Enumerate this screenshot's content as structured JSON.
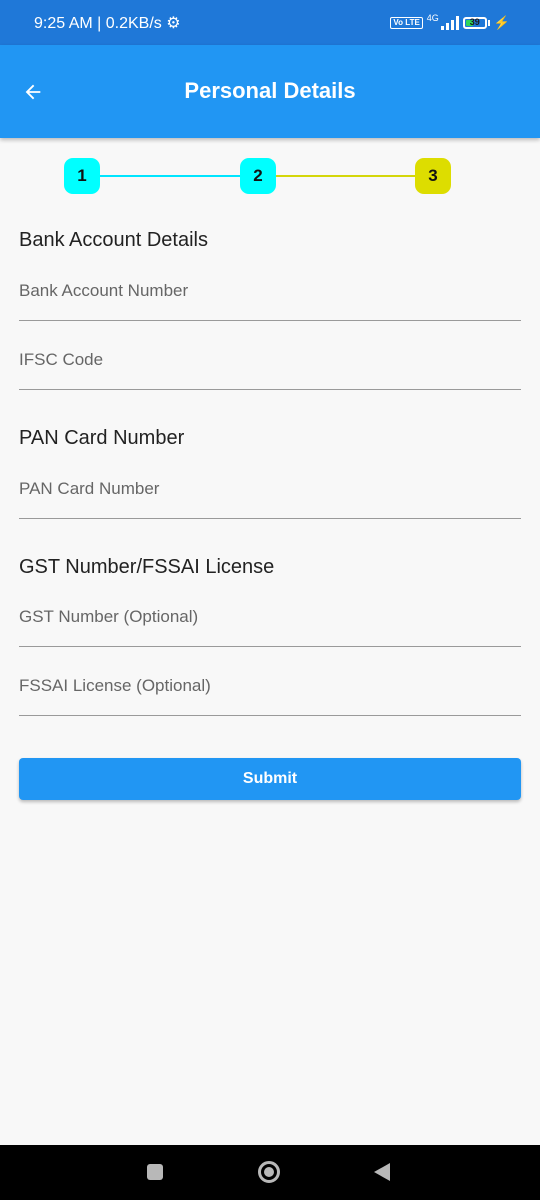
{
  "status_bar": {
    "time_speed": "9:25 AM | 0.2KB/s ⚙",
    "volte_label": "Vo LTE",
    "network_type": "4G",
    "battery_level": "39",
    "battery_percent": 39
  },
  "app_bar": {
    "title": "Personal Details",
    "back_icon": "arrow-left-icon"
  },
  "stepper": {
    "steps": [
      {
        "label": "1",
        "color": "#00ffff"
      },
      {
        "label": "2",
        "color": "#00ffff"
      },
      {
        "label": "3",
        "color": "#dddd00"
      }
    ],
    "line_colors": [
      "#00e5ff",
      "#d4d60a"
    ]
  },
  "sections": {
    "bank": {
      "title": "Bank Account Details",
      "account_number_placeholder": "Bank Account Number",
      "ifsc_placeholder": "IFSC Code"
    },
    "pan": {
      "title": "PAN Card Number",
      "pan_placeholder": "PAN Card Number"
    },
    "gst": {
      "title": "GST Number/FSSAI License",
      "gst_placeholder": "GST Number (Optional)",
      "fssai_placeholder": "FSSAI License (Optional)"
    }
  },
  "submit_label": "Submit",
  "colors": {
    "primary": "#2196f3",
    "status_bar": "#1f78d8"
  }
}
